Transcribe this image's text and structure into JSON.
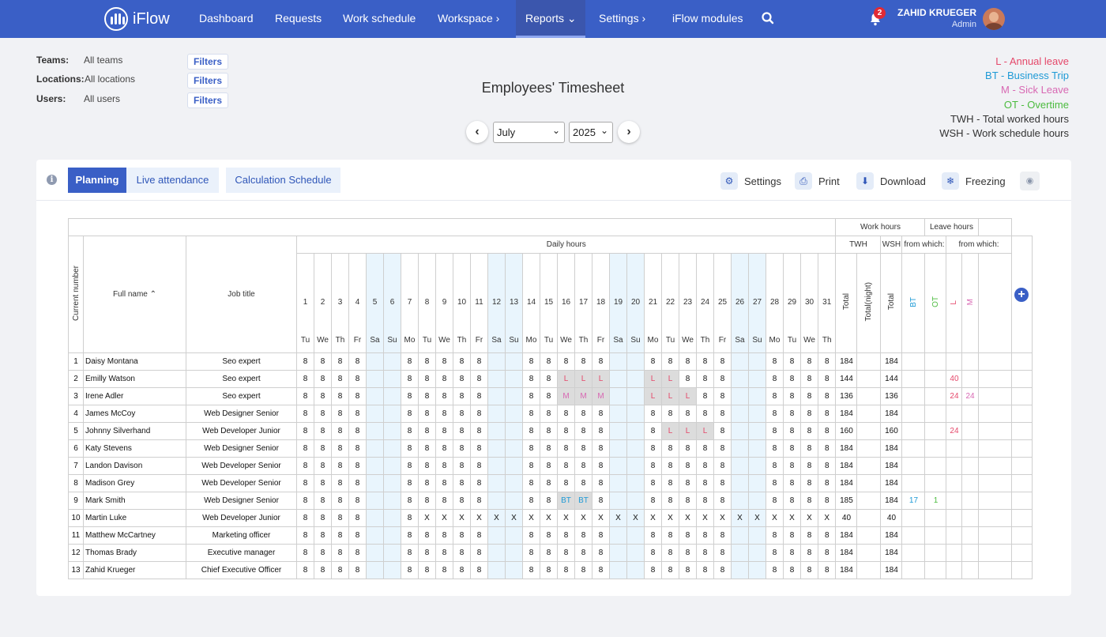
{
  "app": {
    "name": "iFlow"
  },
  "nav": {
    "items": [
      {
        "label": "Dashboard"
      },
      {
        "label": "Requests"
      },
      {
        "label": "Work schedule"
      },
      {
        "label": "Workspace ›"
      },
      {
        "label": "Reports ⌄"
      },
      {
        "label": "Settings ›"
      },
      {
        "label": "iFlow modules"
      }
    ]
  },
  "notifications": {
    "count": "2"
  },
  "user": {
    "name": "ZAHID KRUEGER",
    "role": "Admin"
  },
  "filters": [
    {
      "label": "Teams:",
      "value": "All teams",
      "button": "Filters"
    },
    {
      "label": "Locations:",
      "value": "All locations",
      "button": "Filters"
    },
    {
      "label": "Users:",
      "value": "All users",
      "button": "Filters"
    }
  ],
  "page_title": "Employees' Timesheet",
  "period": {
    "month": "July",
    "year": "2025"
  },
  "legend": [
    {
      "text": "L - Annual leave",
      "color": "#e5486a"
    },
    {
      "text": "BT - Business Trip",
      "color": "#1e9ad6"
    },
    {
      "text": "M - Sick Leave",
      "color": "#d868b3"
    },
    {
      "text": "OT - Overtime",
      "color": "#4bbb3e"
    },
    {
      "text": "TWH - Total worked hours",
      "color": "#333333"
    },
    {
      "text": "WSH - Work schedule hours",
      "color": "#333333"
    }
  ],
  "tabs": {
    "planning": "Planning",
    "live": "Live attendance",
    "calc": "Calculation Schedule"
  },
  "toolbar": {
    "settings": "Settings",
    "print": "Print",
    "download": "Download",
    "freezing": "Freezing"
  },
  "table": {
    "h_work": "Work hours",
    "h_leave": "Leave hours",
    "h_daily": "Daily hours",
    "h_twh": "TWH",
    "h_wsh": "WSH",
    "h_from": "from which:",
    "h_from2": "from which:",
    "h_curr": "Current number",
    "h_name": "Full name",
    "h_job": "Job title",
    "h_total": "Total",
    "h_total_night": "Total(night)",
    "h_total2": "Total",
    "h_bt": "BT",
    "h_ot": "OT",
    "h_l": "L",
    "h_m": "M",
    "days": [
      1,
      2,
      3,
      4,
      5,
      6,
      7,
      8,
      9,
      10,
      11,
      12,
      13,
      14,
      15,
      16,
      17,
      18,
      19,
      20,
      21,
      22,
      23,
      24,
      25,
      26,
      27,
      28,
      29,
      30,
      31
    ],
    "dows": [
      "Tu",
      "We",
      "Th",
      "Fr",
      "Sa",
      "Su",
      "Mo",
      "Tu",
      "We",
      "Th",
      "Fr",
      "Sa",
      "Su",
      "Mo",
      "Tu",
      "We",
      "Th",
      "Fr",
      "Sa",
      "Su",
      "Mo",
      "Tu",
      "We",
      "Th",
      "Fr",
      "Sa",
      "Su",
      "Mo",
      "Tu",
      "We",
      "Th"
    ],
    "rows": [
      {
        "n": "1",
        "name": "Daisy Montana",
        "job": "Seo expert",
        "d": "8888..88888..88888..88888..8888",
        "twh": "184",
        "tn": "",
        "wsh": "184",
        "bt": "",
        "ot": "",
        "l": "",
        "m": ""
      },
      {
        "n": "2",
        "name": "Emilly Watson",
        "job": "Seo expert",
        "d": "8888..88888..88LLL..LL888..8888",
        "twh": "144",
        "tn": "",
        "wsh": "144",
        "bt": "",
        "ot": "",
        "l": "40",
        "m": ""
      },
      {
        "n": "3",
        "name": "Irene Adler",
        "job": "Seo expert",
        "d": "8888..88888..88MMM..LLL88..8888",
        "twh": "136",
        "tn": "",
        "wsh": "136",
        "bt": "",
        "ot": "",
        "l": "24",
        "m": "24"
      },
      {
        "n": "4",
        "name": "James McCoy",
        "job": "Web Designer Senior",
        "d": "8888..88888..88888..88888..8888",
        "twh": "184",
        "tn": "",
        "wsh": "184",
        "bt": "",
        "ot": "",
        "l": "",
        "m": ""
      },
      {
        "n": "5",
        "name": "Johnny Silverhand",
        "job": "Web Developer Junior",
        "d": "8888..88888..88888..8LLL8..8888",
        "twh": "160",
        "tn": "",
        "wsh": "160",
        "bt": "",
        "ot": "",
        "l": "24",
        "m": ""
      },
      {
        "n": "6",
        "name": "Katy Stevens",
        "job": "Web Designer Senior",
        "d": "8888..88888..88888..88888..8888",
        "twh": "184",
        "tn": "",
        "wsh": "184",
        "bt": "",
        "ot": "",
        "l": "",
        "m": ""
      },
      {
        "n": "7",
        "name": "Landon Davison",
        "job": "Web Developer Senior",
        "d": "8888..88888..88888..88888..8888",
        "twh": "184",
        "tn": "",
        "wsh": "184",
        "bt": "",
        "ot": "",
        "l": "",
        "m": ""
      },
      {
        "n": "8",
        "name": "Madison Grey",
        "job": "Web Developer Senior",
        "d": "8888..88888..88888..88888..8888",
        "twh": "184",
        "tn": "",
        "wsh": "184",
        "bt": "",
        "ot": "",
        "l": "",
        "m": ""
      },
      {
        "n": "9",
        "name": "Mark Smith",
        "job": "Web Designer Senior",
        "d": "8888..88888..88BB8..88888..8888",
        "twh": "185",
        "tn": "",
        "wsh": "184",
        "bt": "17",
        "ot": "1",
        "l": "",
        "m": ""
      },
      {
        "n": "10",
        "name": "Martin Luke",
        "job": "Web Developer Junior",
        "d": "8888..8XXXXXXXXXXXXXXXXXXXXXXXX",
        "twh": "40",
        "tn": "",
        "wsh": "40",
        "bt": "",
        "ot": "",
        "l": "",
        "m": ""
      },
      {
        "n": "11",
        "name": "Matthew McCartney",
        "job": "Marketing officer",
        "d": "8888..88888..88888..88888..8888",
        "twh": "184",
        "tn": "",
        "wsh": "184",
        "bt": "",
        "ot": "",
        "l": "",
        "m": ""
      },
      {
        "n": "12",
        "name": "Thomas Brady",
        "job": "Executive manager",
        "d": "8888..88888..88888..88888..8888",
        "twh": "184",
        "tn": "",
        "wsh": "184",
        "bt": "",
        "ot": "",
        "l": "",
        "m": ""
      },
      {
        "n": "13",
        "name": "Zahid Krueger",
        "job": "Chief Executive Officer",
        "d": "8888..88888..88888..88888..8888",
        "twh": "184",
        "tn": "",
        "wsh": "184",
        "bt": "",
        "ot": "",
        "l": "",
        "m": ""
      }
    ]
  }
}
